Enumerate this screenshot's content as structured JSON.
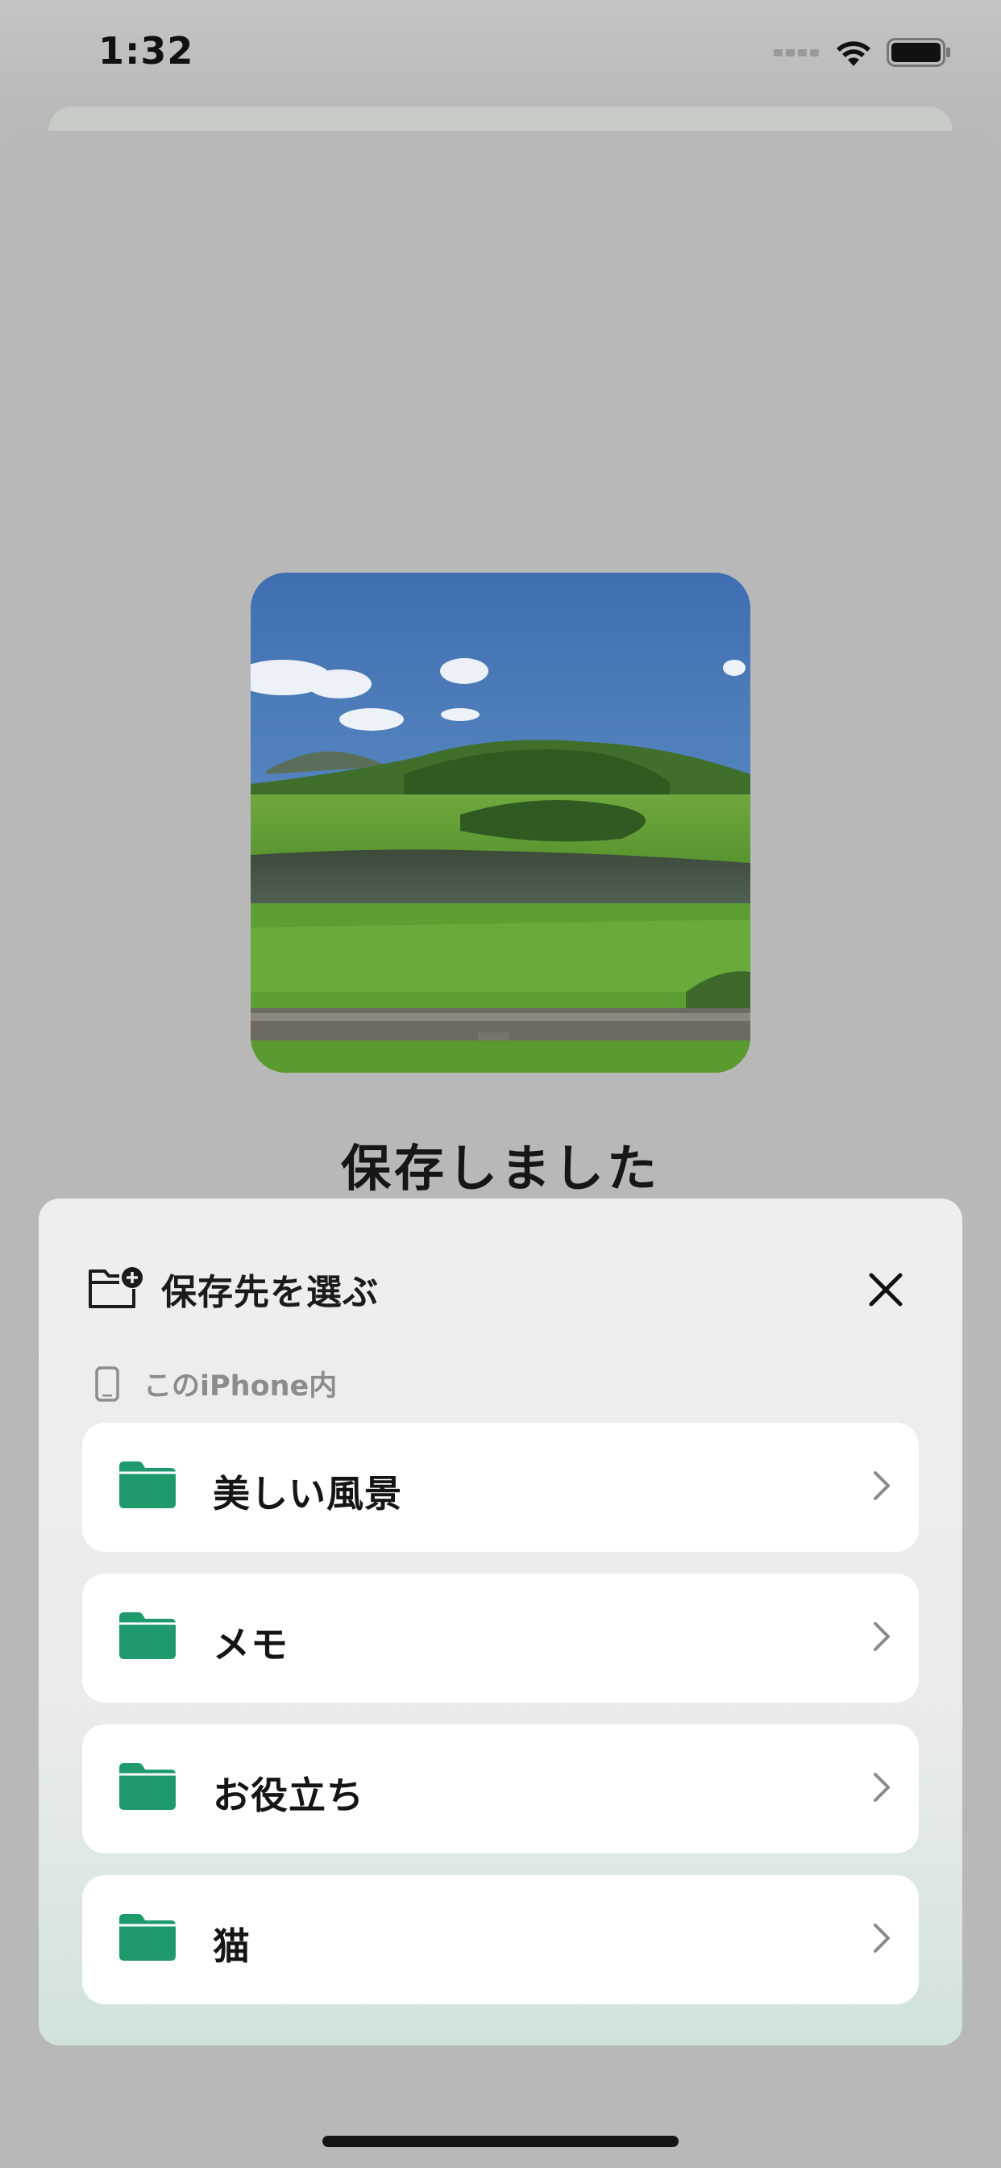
{
  "status_bar": {
    "time": "1:32"
  },
  "result": {
    "title": "保存しました"
  },
  "picker": {
    "title": "保存先を選ぶ",
    "section_label": "このiPhone内",
    "folders": [
      {
        "name": "美しい風景"
      },
      {
        "name": "メモ"
      },
      {
        "name": "お役立ち"
      },
      {
        "name": "猫"
      }
    ]
  },
  "colors": {
    "folder_green": "#1f9a6c",
    "panel_bg": "#ececec",
    "row_bg": "#ffffff"
  }
}
